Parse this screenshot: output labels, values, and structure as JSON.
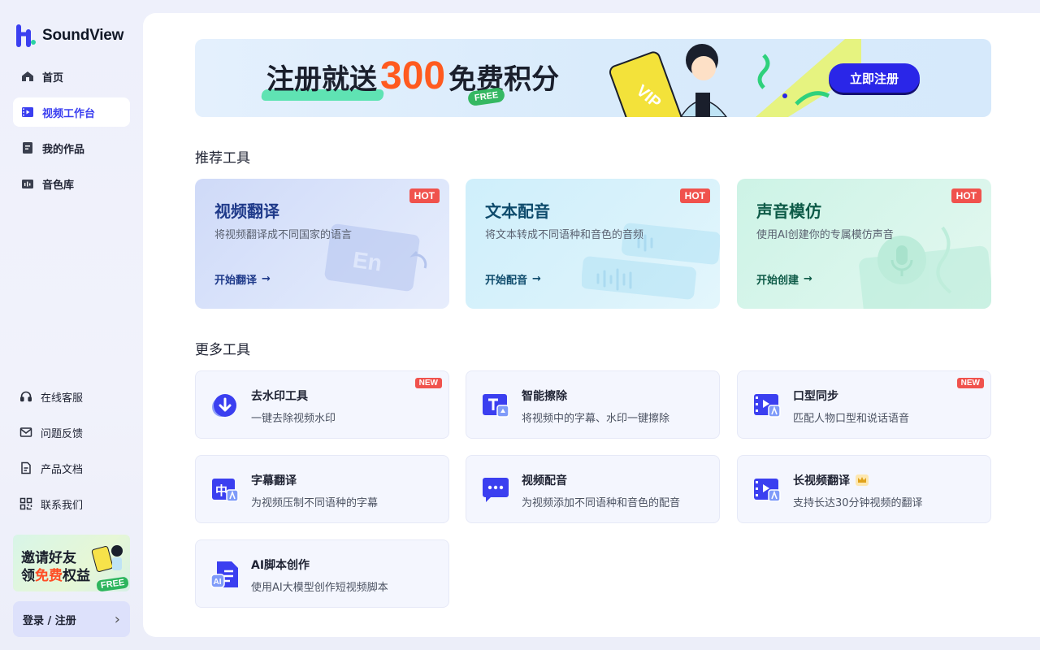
{
  "brand": {
    "name": "SoundView",
    "accent": "#3b3ff0"
  },
  "sidebar": {
    "items": [
      {
        "label": "首页",
        "icon": "home-icon",
        "active": false
      },
      {
        "label": "视频工作台",
        "icon": "video-workbench-icon",
        "active": true
      },
      {
        "label": "我的作品",
        "icon": "document-icon",
        "active": false
      },
      {
        "label": "音色库",
        "icon": "audio-library-icon",
        "active": false
      }
    ],
    "support": [
      {
        "label": "在线客服",
        "icon": "headset-icon"
      },
      {
        "label": "问题反馈",
        "icon": "mail-icon"
      },
      {
        "label": "产品文档",
        "icon": "file-text-icon"
      },
      {
        "label": "联系我们",
        "icon": "qrcode-icon"
      }
    ],
    "invite": {
      "line1": "邀请好友",
      "line2_a": "领",
      "line2_hl": "免费",
      "line2_b": "权益",
      "badge": "FREE"
    },
    "login": {
      "label": "登录 / 注册",
      "chevron": "›"
    }
  },
  "banner": {
    "text_a": "注册就送",
    "number": "300",
    "text_b": "免费积分",
    "free_badge": "FREE",
    "vip_label": "VIP",
    "button": "立即注册"
  },
  "sections": {
    "recommended": "推荐工具",
    "more": "更多工具"
  },
  "recommended": [
    {
      "title": "视频翻译",
      "desc": "将视频翻译成不同国家的语言",
      "action": "开始翻译",
      "badge": "HOT",
      "deco_text": "En"
    },
    {
      "title": "文本配音",
      "desc": "将文本转成不同语种和音色的音频",
      "action": "开始配音",
      "badge": "HOT"
    },
    {
      "title": "声音模仿",
      "desc": "使用AI创建你的专属模仿声音",
      "action": "开始创建",
      "badge": "HOT"
    }
  ],
  "tools": [
    {
      "title": "去水印工具",
      "desc": "一键去除视频水印",
      "badge": "NEW",
      "icon": "download-circle-icon"
    },
    {
      "title": "智能擦除",
      "desc": "将视频中的字幕、水印一键擦除",
      "badge": "",
      "icon": "text-erase-icon"
    },
    {
      "title": "口型同步",
      "desc": "匹配人物口型和说话语音",
      "badge": "NEW",
      "icon": "lip-sync-icon"
    },
    {
      "title": "字幕翻译",
      "desc": "为视频压制不同语种的字幕",
      "badge": "",
      "icon": "subtitle-translate-icon",
      "glyph": "中"
    },
    {
      "title": "视频配音",
      "desc": "为视频添加不同语种和音色的配音",
      "badge": "",
      "icon": "chat-dubbing-icon"
    },
    {
      "title": "长视频翻译",
      "desc": "支持长达30分钟视频的翻译",
      "badge": "",
      "icon": "long-video-icon",
      "crown": true
    },
    {
      "title": "AI脚本创作",
      "desc": "使用AI大模型创作短视频脚本",
      "badge": "",
      "icon": "ai-script-icon",
      "glyph": "AI"
    }
  ]
}
